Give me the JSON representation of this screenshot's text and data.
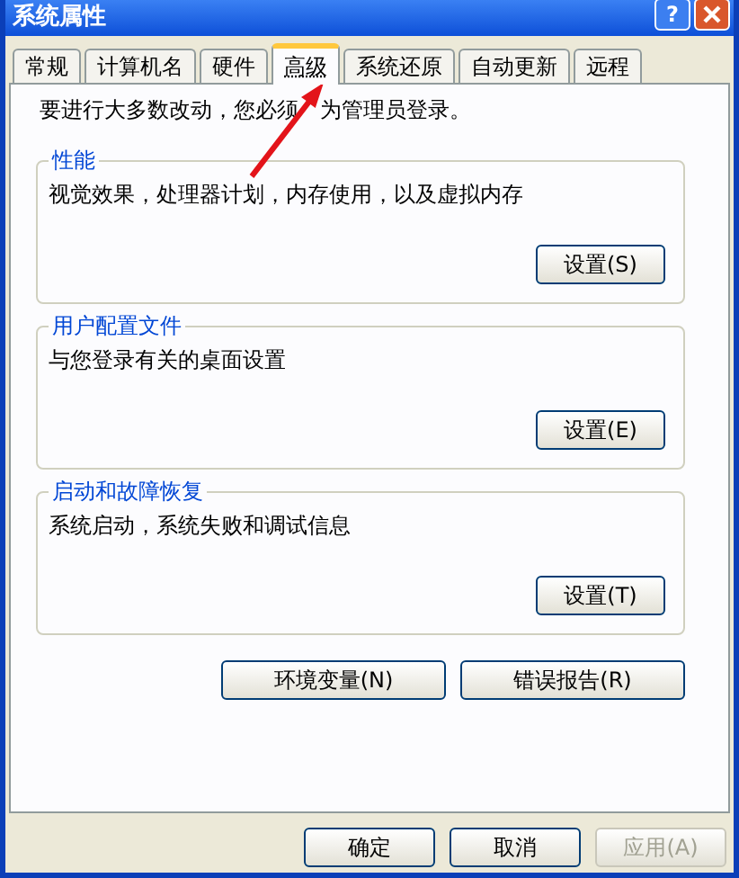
{
  "window": {
    "title": "系统属性",
    "help": "?"
  },
  "tabs": [
    {
      "label": "常规",
      "selected": false
    },
    {
      "label": "计算机名",
      "selected": false
    },
    {
      "label": "硬件",
      "selected": false
    },
    {
      "label": "高级",
      "selected": true
    },
    {
      "label": "系统还原",
      "selected": false
    },
    {
      "label": "自动更新",
      "selected": false
    },
    {
      "label": "远程",
      "selected": false
    }
  ],
  "notice": [
    "要进行大多数改动，您必须",
    "为管理员登录。"
  ],
  "groups": [
    {
      "title": "性能",
      "description": "视觉效果，处理器计划，内存使用，以及虚拟内存",
      "button": "设置(S)"
    },
    {
      "title": "用户配置文件",
      "description": "与您登录有关的桌面设置",
      "button": "设置(E)"
    },
    {
      "title": "启动和故障恢复",
      "description": "系统启动，系统失败和调试信息",
      "button": "设置(T)"
    }
  ],
  "extra_buttons": [
    "环境变量(N)",
    "错误报告(R)"
  ],
  "dialog_buttons": [
    {
      "label": "确定",
      "disabled": false
    },
    {
      "label": "取消",
      "disabled": false
    },
    {
      "label": "应用(A)",
      "disabled": true
    }
  ]
}
